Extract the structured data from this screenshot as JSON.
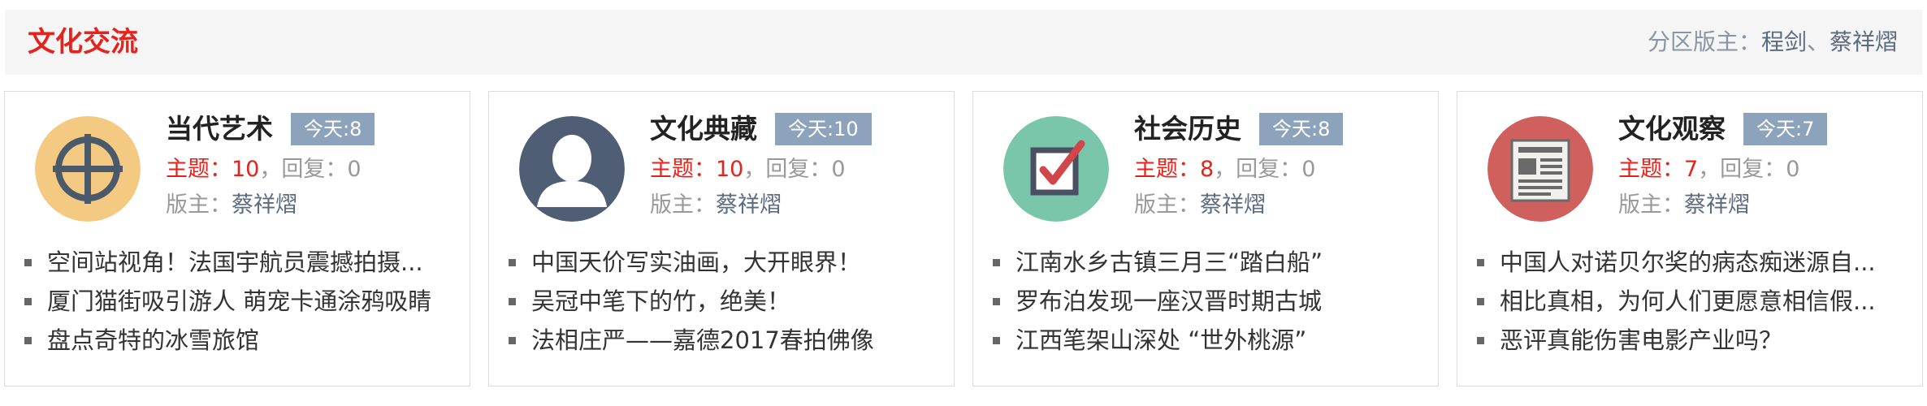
{
  "section": {
    "title": "文化交流",
    "moderators_label": "分区版主：",
    "moderators": [
      "程剑",
      "蔡祥熠"
    ],
    "moderator_separator": "、"
  },
  "cards": [
    {
      "title": "当代艺术",
      "today": "今天:8",
      "topics_label": "主题：",
      "topics": "10",
      "replies_label": "，回复：",
      "replies": "0",
      "mod_label": "版主：",
      "mod": "蔡祥熠",
      "icon": "target-crosshair-icon",
      "icon_color": "#f4c982",
      "posts": [
        "空间站视角！法国宇航员震撼拍摄...",
        "厦门猫街吸引游人 萌宠卡通涂鸦吸睛",
        "盘点奇特的冰雪旅馆"
      ]
    },
    {
      "title": "文化典藏",
      "today": "今天:10",
      "topics_label": "主题：",
      "topics": "10",
      "replies_label": "，回复：",
      "replies": "0",
      "mod_label": "版主：",
      "mod": "蔡祥熠",
      "icon": "user-silhouette-icon",
      "icon_color": "#4f5d75",
      "posts": [
        "中国天价写实油画，大开眼界！",
        "吴冠中笔下的竹，绝美！",
        "法相庄严——嘉德2017春拍佛像"
      ]
    },
    {
      "title": "社会历史",
      "today": "今天:8",
      "topics_label": "主题：",
      "topics": "8",
      "replies_label": "，回复：",
      "replies": "0",
      "mod_label": "版主：",
      "mod": "蔡祥熠",
      "icon": "checkbox-checked-icon",
      "icon_color": "#79c6ab",
      "posts": [
        "江南水乡古镇三月三“踏白船”",
        "罗布泊发现一座汉晋时期古城",
        "江西笔架山深处 “世外桃源”"
      ]
    },
    {
      "title": "文化观察",
      "today": "今天:7",
      "topics_label": "主题：",
      "topics": "7",
      "replies_label": "，回复：",
      "replies": "0",
      "mod_label": "版主：",
      "mod": "蔡祥熠",
      "icon": "newspaper-icon",
      "icon_color": "#d0605d",
      "posts": [
        "中国人对诺贝尔奖的病态痴迷源自...",
        "相比真相，为何人们更愿意相信假...",
        "恶评真能伤害电影产业吗？"
      ]
    }
  ]
}
